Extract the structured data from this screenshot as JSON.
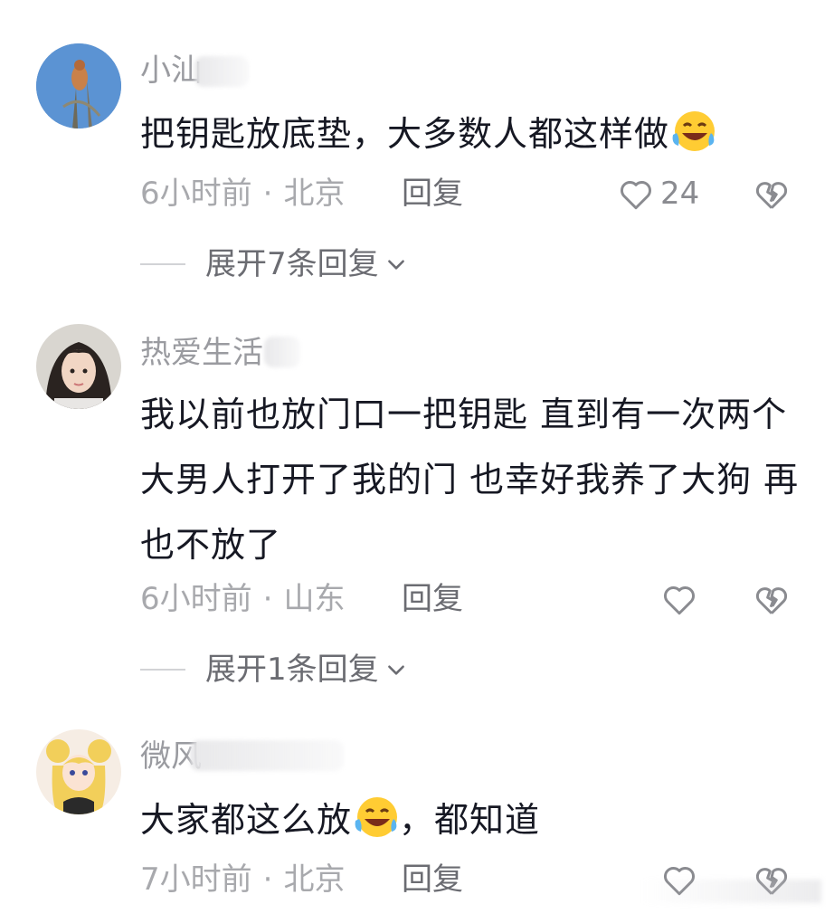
{
  "comments": [
    {
      "username": "小汕",
      "text_before_emoji": "把钥匙放底垫，大多数人都这样做",
      "text_after_emoji": "",
      "time": "6小时前",
      "location": "北京",
      "reply_label": "回复",
      "like_count": "24",
      "expand_label": "展开7条回复"
    },
    {
      "username": "热爱生活",
      "text": "我以前也放门口一把钥匙 直到有一次两个大男人打开了我的门 也幸好我养了大狗 再也不放了",
      "time": "6小时前",
      "location": "山东",
      "reply_label": "回复",
      "like_count": "",
      "expand_label": "展开1条回复"
    },
    {
      "username": "微风",
      "text_before_emoji": "大家都这么放",
      "text_after_emoji": "，都知道",
      "time": "7小时前",
      "location": "北京",
      "reply_label": "回复",
      "like_count": ""
    }
  ],
  "separator": "·",
  "icons": {
    "like": "heart-outline-icon",
    "dislike": "broken-heart-icon",
    "expand": "chevron-down-icon",
    "emoji": "laughing-crying-emoji-icon"
  },
  "colors": {
    "text": "#161823",
    "meta": "#a8a9ad",
    "username": "#9a9ba0"
  }
}
